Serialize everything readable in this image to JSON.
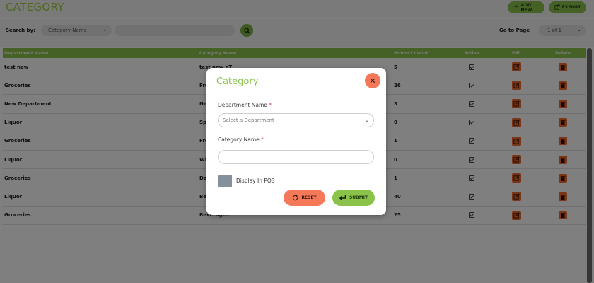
{
  "header": {
    "title": "CATEGORY",
    "add_new_label": "ADD NEW",
    "export_label": "EXPORT"
  },
  "filter": {
    "search_by_label": "Search by:",
    "search_field_value": "Category Name",
    "search_placeholder": "",
    "goto_label": "Go to Page",
    "page_value": "1 of 1"
  },
  "table": {
    "columns": [
      "Department Name",
      "Category Name",
      "Product Count",
      "Active",
      "Edit",
      "Delete"
    ],
    "rows": [
      {
        "department": "test new",
        "category": "test new eT",
        "count": "5",
        "active": true
      },
      {
        "department": "Groceries",
        "category": "Fruits",
        "count": "26",
        "active": true
      },
      {
        "department": "New Department",
        "category": "New",
        "count": "3",
        "active": true
      },
      {
        "department": "Liquor",
        "category": "Spirits",
        "count": "0",
        "active": true
      },
      {
        "department": "Groceries",
        "category": "Fresh",
        "count": "1",
        "active": true
      },
      {
        "department": "Liquor",
        "category": "Wine",
        "count": "0",
        "active": true
      },
      {
        "department": "Groceries",
        "category": "Deli",
        "count": "1",
        "active": true
      },
      {
        "department": "Liquor",
        "category": "Beer",
        "count": "40",
        "active": true
      },
      {
        "department": "Groceries",
        "category": "Beverages",
        "count": "25",
        "active": true
      }
    ]
  },
  "modal": {
    "title": "Category",
    "department_label": "Department Name",
    "department_placeholder": "Select a Department",
    "category_label": "Category Name",
    "category_value": "",
    "display_pos_label": "Display In POS",
    "display_pos_checked": false,
    "reset_label": "RESET",
    "submit_label": "SUBMIT"
  },
  "colors": {
    "accent_green": "#8bc34a",
    "accent_orange": "#f26b2b",
    "close_salmon": "#f57859"
  }
}
